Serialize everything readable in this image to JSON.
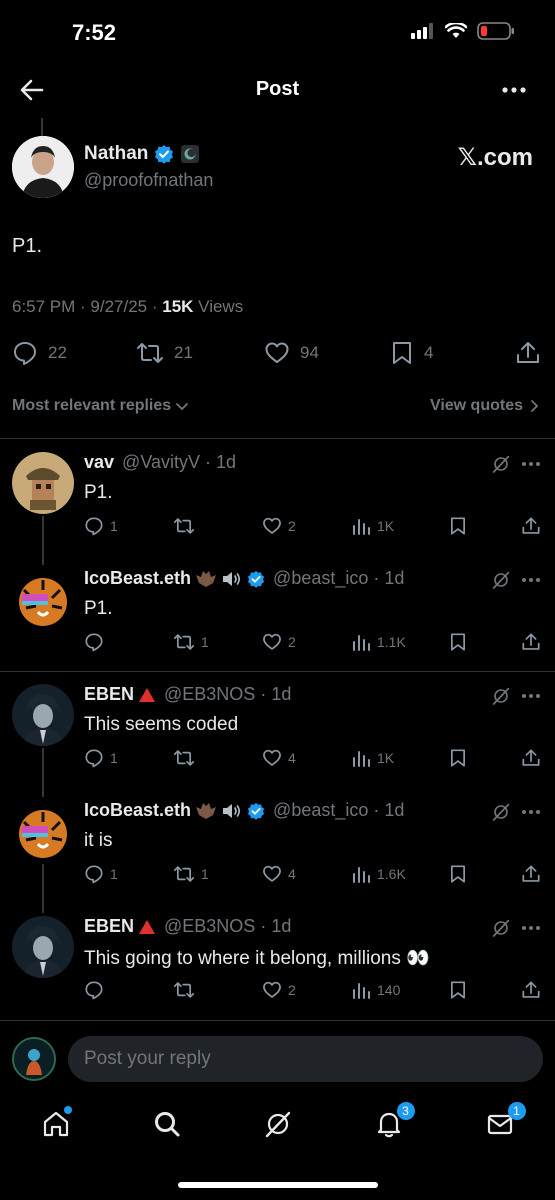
{
  "status": {
    "time": "7:52"
  },
  "header": {
    "title": "Post"
  },
  "main_post": {
    "name": "Nathan",
    "handle": "@proofofnathan",
    "brand": "𝕏.com",
    "text": "P1.",
    "time": "6:57 PM · 9/27/25 · ",
    "views_count": "15K",
    "views_label": " Views",
    "stats": {
      "replies": "22",
      "reposts": "21",
      "likes": "94",
      "bookmarks": "4"
    }
  },
  "sort": {
    "left": "Most relevant replies",
    "right": "View quotes"
  },
  "replies": [
    {
      "name": "vav",
      "handle": "@VavityV · 1d",
      "text": "P1.",
      "reply": "1",
      "repost": "",
      "like": "2",
      "views": "1K"
    },
    {
      "name": "IcoBeast.eth",
      "handle": "@beast_ico · 1d",
      "text": "P1.",
      "reply": "",
      "repost": "1",
      "like": "2",
      "views": "1.1K"
    },
    {
      "name": "EBEN",
      "handle": "@EB3NOS · 1d",
      "text": "This seems coded",
      "reply": "1",
      "repost": "",
      "like": "4",
      "views": "1K"
    },
    {
      "name": "IcoBeast.eth",
      "handle": "@beast_ico · 1d",
      "text": "it is",
      "reply": "1",
      "repost": "1",
      "like": "4",
      "views": "1.6K"
    },
    {
      "name": "EBEN",
      "handle": "@EB3NOS · 1d",
      "text": "This going to where it belong, millions 👀",
      "reply": "",
      "repost": "",
      "like": "2",
      "views": "140"
    }
  ],
  "composer": {
    "placeholder": "Post your reply"
  },
  "nav": {
    "notifications_badge": "3",
    "messages_badge": "1"
  },
  "colors": {
    "accent": "#1d9bf0",
    "background": "#000000",
    "muted": "#71767b"
  }
}
